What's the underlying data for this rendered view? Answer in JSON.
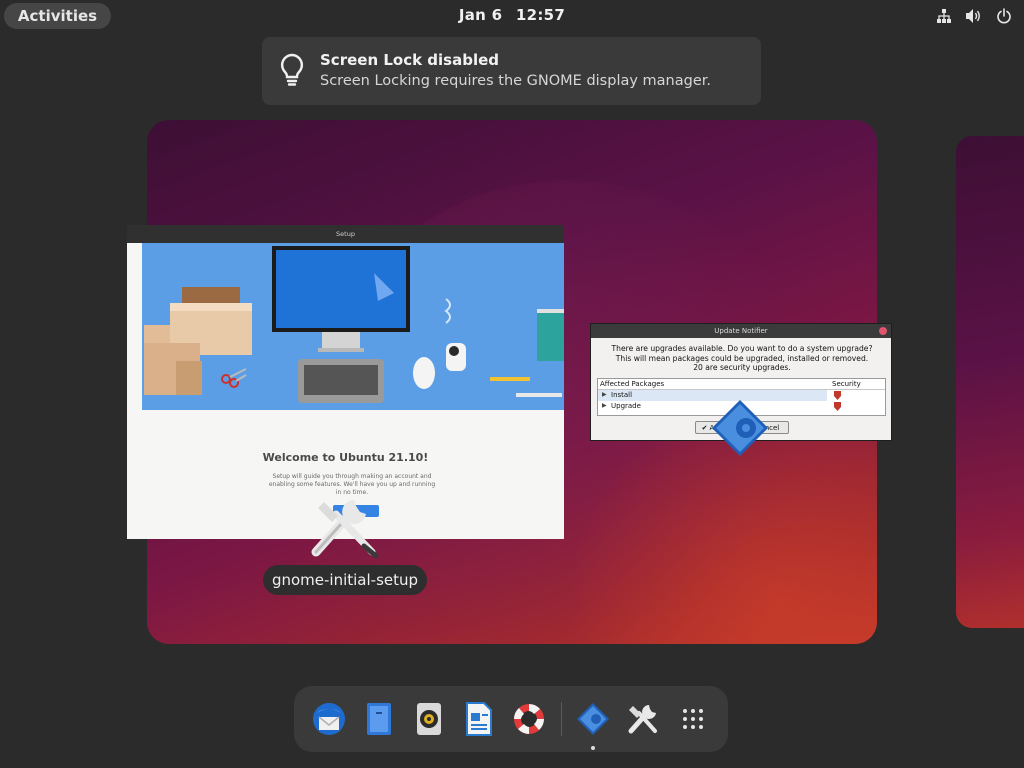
{
  "topbar": {
    "activities_label": "Activities",
    "date": "Jan 6",
    "time": "12:57",
    "tray_icons": [
      "network-icon",
      "volume-icon",
      "power-icon"
    ]
  },
  "notification": {
    "title": "Screen Lock disabled",
    "body": "Screen Locking requires the GNOME display manager.",
    "icon": "lightbulb-icon"
  },
  "setup_window": {
    "title": "Setup",
    "welcome": "Welcome to Ubuntu 21.10!",
    "description": "Setup will guide you through making an account and enabling some features. We'll have you up and running in no time.",
    "label": "gnome-initial-setup"
  },
  "update_notifier": {
    "title": "Update Notifier",
    "message_line1": "There are upgrades available. Do you want to do a system upgrade?",
    "message_line2": "This will mean packages could be upgraded, installed or removed.",
    "message_line3": "20 are security upgrades.",
    "col_packages": "Affected Packages",
    "col_security": "Security",
    "rows": [
      {
        "label": "Install"
      },
      {
        "label": "Upgrade"
      }
    ],
    "ok_label": "A",
    "cancel_label": "ncel"
  },
  "dock": {
    "items": [
      "thunderbird-icon",
      "files-icon",
      "rhythmbox-icon",
      "writer-icon",
      "help-icon",
      "update-notifier-icon",
      "tools-icon",
      "app-grid-icon"
    ]
  },
  "colors": {
    "accent": "#3584e4",
    "panel": "#2b2b2b",
    "wallpaper_dark": "#3d0f35",
    "wallpaper_light": "#c0372a"
  }
}
